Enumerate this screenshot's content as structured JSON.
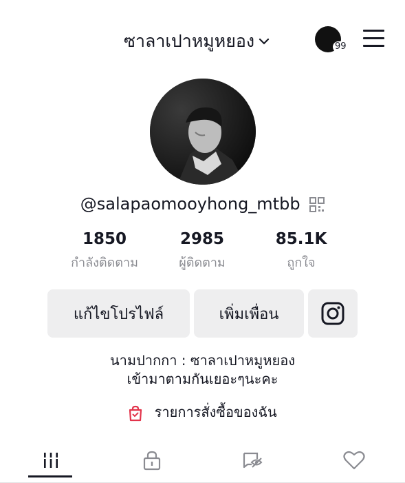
{
  "header": {
    "username": "ซาลาเปาหมูหยอง",
    "notification_count": "99"
  },
  "profile": {
    "handle": "@salapaomooyhong_mtbb"
  },
  "stats": [
    {
      "value": "1850",
      "label": "กำลังติดตาม"
    },
    {
      "value": "2985",
      "label": "ผู้ติดตาม"
    },
    {
      "value": "85.1K",
      "label": "ถูกใจ"
    }
  ],
  "actions": {
    "edit_profile": "แก้ไขโปรไฟล์",
    "add_friends": "เพิ่มเพื่อน"
  },
  "bio": {
    "line1": "นามปากกา : ซาลาเปาหมูหยอง",
    "line2": "เข้ามาตามกันเยอะๆนะคะ"
  },
  "shop": {
    "label": "รายการสั่งซื้อของฉัน"
  },
  "icons": {
    "menu": "hamburger-icon",
    "qr": "qr-code-icon",
    "instagram": "instagram-icon",
    "bag": "shopping-bag-icon",
    "grid": "grid-icon",
    "lock": "lock-icon",
    "repost": "repost-icon",
    "liked": "heart-icon"
  },
  "colors": {
    "text": "#161823",
    "muted": "#8a8b91",
    "button_bg": "#eeeeef",
    "shop_icon": "#e2334a"
  }
}
